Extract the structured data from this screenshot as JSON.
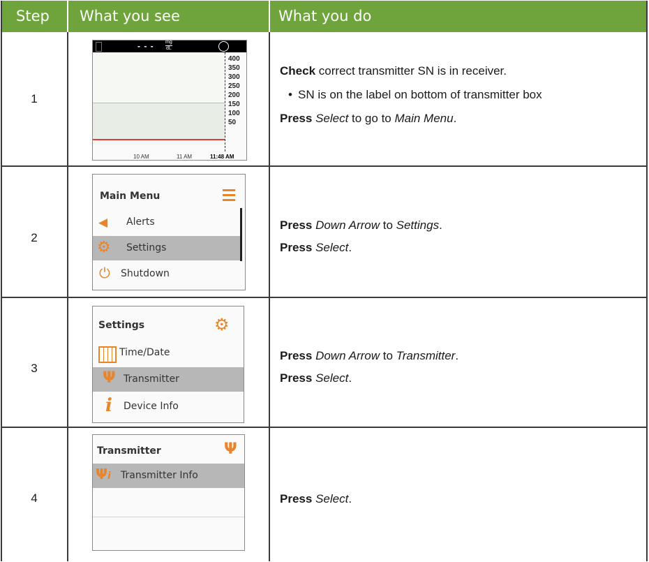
{
  "header": {
    "col_step": "Step",
    "col_see": "What you see",
    "col_do": "What you do"
  },
  "rows": [
    {
      "step": "1",
      "screen": {
        "units_top": "mg",
        "units_bottom": "dL",
        "value": "- - -",
        "ticks": [
          "400",
          "350",
          "300",
          "250",
          "200",
          "150",
          "100",
          "50"
        ],
        "x_labels": [
          "10 AM",
          "11 AM",
          "11:48 AM"
        ]
      },
      "line1_bold": "Check",
      "line1_rest": " correct transmitter SN is in receiver.",
      "bullet": "SN is on the label on bottom of transmitter box",
      "line3_bold": "Press",
      "line3_italic1": "Select",
      "line3_mid": " to go to ",
      "line3_italic2": "Main Menu",
      "line3_end": "."
    },
    {
      "step": "2",
      "screen": {
        "title": "Main Menu",
        "items": [
          "Alerts",
          "Settings",
          "Shutdown"
        ]
      },
      "line1_bold": "Press",
      "line1_italic1": "Down Arrow",
      "line1_mid": " to ",
      "line1_italic2": "Settings",
      "line1_end": ".",
      "line2_bold": "Press",
      "line2_italic": "Select",
      "line2_end": "."
    },
    {
      "step": "3",
      "screen": {
        "title": "Settings",
        "items": [
          "Time/Date",
          "Transmitter",
          "Device Info"
        ]
      },
      "line1_bold": "Press",
      "line1_italic1": "Down Arrow",
      "line1_mid": " to ",
      "line1_italic2": "Transmitter",
      "line1_end": ".",
      "line2_bold": "Press",
      "line2_italic": "Select",
      "line2_end": "."
    },
    {
      "step": "4",
      "screen": {
        "title": "Transmitter",
        "items": [
          "Transmitter Info"
        ]
      },
      "line1_bold": "Press",
      "line1_italic": "Select",
      "line1_end": "."
    }
  ],
  "colors": {
    "header_green": "#6ea43b",
    "icon_orange": "#e8852a",
    "selected_gray": "#b7b7b7"
  }
}
